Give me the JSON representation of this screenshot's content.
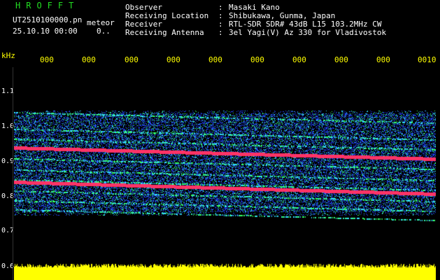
{
  "header": {
    "title": "HROFFT",
    "filename": "UT2510100000.pn",
    "mode": "meteor",
    "timestamp": "25.10.10 00:00",
    "status": "0.."
  },
  "info": [
    {
      "label": "Observer",
      "sep": ":",
      "value": "Masaki Kano"
    },
    {
      "label": "Receiving Location",
      "sep": ":",
      "value": "Shibukawa, Gunma, Japan"
    },
    {
      "label": "Receiver",
      "sep": ":",
      "value": "RTL-SDR SDR# 43dB L15 103.2MHz CW"
    },
    {
      "label": "Receiving Antenna",
      "sep": ":",
      "value": "3el Yagi(V) Az 330 for Vladivostok"
    }
  ],
  "axis": {
    "unit": "kHz",
    "y_labels": [
      "1.1",
      "1.0",
      "0.9",
      "0.8",
      "0.7",
      "0.6"
    ],
    "x_labels": [
      "000",
      "000",
      "000",
      "000",
      "000",
      "000",
      "000",
      "000",
      "000",
      "0010"
    ]
  },
  "colors": {
    "background": "#000000",
    "text_green": "#22dd22",
    "text_white": "#ffffff",
    "axis_yellow": "#ffff00",
    "echo_red": "#ff3366",
    "noise_blue": "#2244ff",
    "noise_cyan": "#33ddff",
    "noise_green": "#33ff66",
    "level_yellow": "#ffff00"
  }
}
